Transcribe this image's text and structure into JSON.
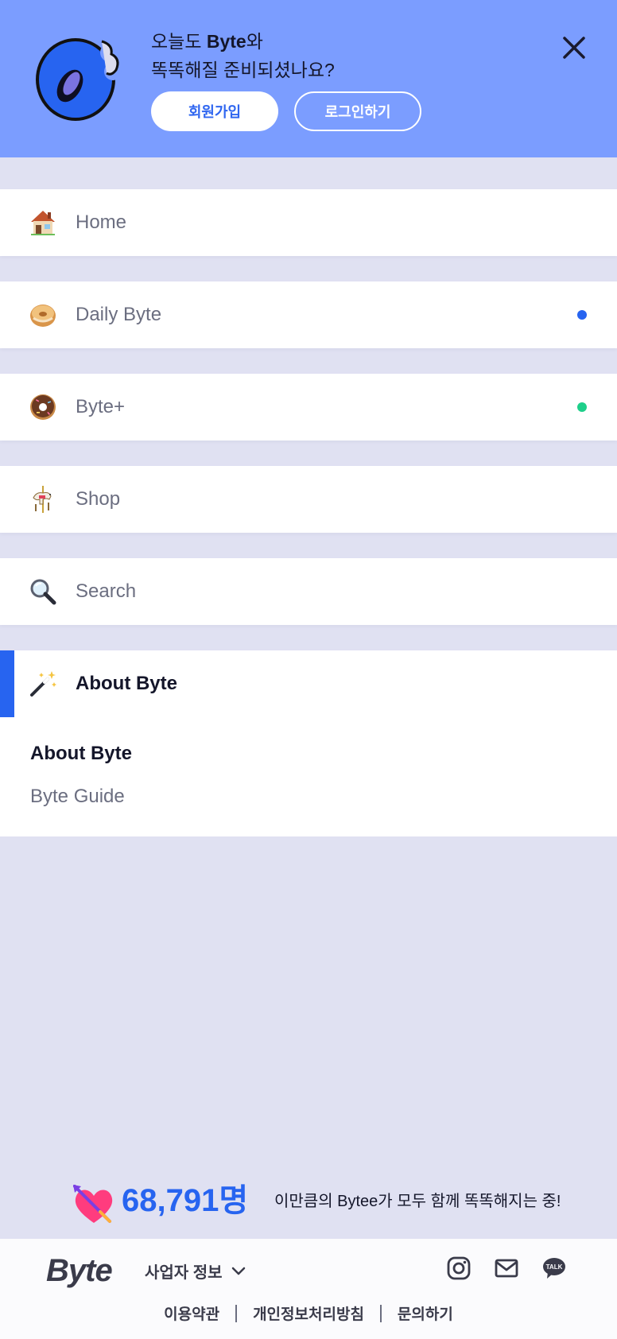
{
  "header": {
    "welcome_line1_prefix": "오늘도 ",
    "welcome_line1_brand": "Byte",
    "welcome_line1_suffix": "와",
    "welcome_line2": "똑똑해질 준비되셨나요?",
    "signup_label": "회원가입",
    "login_label": "로그인하기",
    "logo_icon": "donut-logo-icon",
    "close_icon": "close-icon"
  },
  "menu": {
    "items": [
      {
        "label": "Home",
        "icon": "house-icon"
      },
      {
        "label": "Daily Byte",
        "icon": "bagel-icon",
        "dot_color": "#2764f0"
      },
      {
        "label": "Byte+",
        "icon": "donut-icon",
        "dot_color": "#1ecf8a"
      },
      {
        "label": "Shop",
        "icon": "carousel-horse-icon"
      },
      {
        "label": "Search",
        "icon": "magnifier-icon"
      },
      {
        "label": "About Byte",
        "icon": "magic-wand-icon",
        "active": true
      }
    ],
    "submenu": [
      {
        "label": "About Byte",
        "current": true
      },
      {
        "label": "Byte Guide"
      }
    ]
  },
  "counter": {
    "number": "68,791명",
    "text": "이만큼의 Bytee가 모두 함께 똑똑해지는 중!"
  },
  "footer": {
    "brand": "Byte",
    "business_info_label": "사업자 정보",
    "social": [
      "instagram-icon",
      "mail-icon",
      "kakaotalk-icon"
    ],
    "talk_label": "TALK",
    "links": [
      "이용약관",
      "개인정보처리방침",
      "문의하기"
    ]
  },
  "colors": {
    "header_bg": "#7b9dff",
    "accent": "#2764f0",
    "page_bg": "#e0e1f2",
    "new_dot_green": "#1ecf8a"
  }
}
